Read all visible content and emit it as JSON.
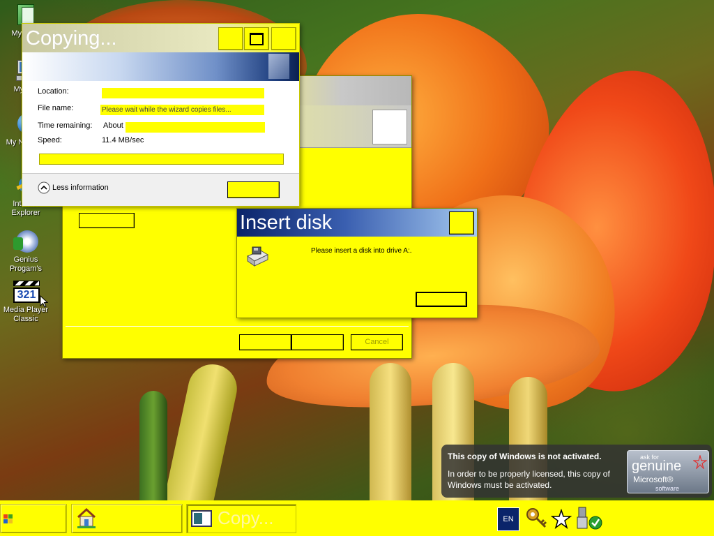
{
  "desktop": {
    "icons": [
      {
        "id": "my-documents",
        "label": "My Do..."
      },
      {
        "id": "my-computer",
        "label": "My C..."
      },
      {
        "id": "my-network-places",
        "label": "My N... Pl..."
      },
      {
        "id": "internet-explorer",
        "label": "Internet Explorer"
      },
      {
        "id": "genius-programs",
        "label": "Genius Progam's"
      },
      {
        "id": "media-player-classic",
        "label": "Media Player Classic"
      }
    ]
  },
  "copying_dialog": {
    "title": "Copying...",
    "location_label": "Location:",
    "location_value": "",
    "file_name_label": "File name:",
    "file_name_value": "Please wait while the wizard copies files...",
    "time_remaining_label": "Time remaining:",
    "time_remaining_value": "About",
    "speed_label": "Speed:",
    "speed_value": "11.4 MB/sec",
    "progress_fraction": 0.0,
    "less_info_label": "Less information",
    "cancel_label": ""
  },
  "wizard_window": {
    "cancel_label": "Cancel",
    "back_label": "",
    "next_label": ""
  },
  "insert_disk_dialog": {
    "title": "Insert disk",
    "message": "Please insert a disk into drive A:.",
    "ok_label": ""
  },
  "activation_balloon": {
    "heading": "This copy of Windows is not activated.",
    "body": "In order to be properly licensed, this copy of Windows must be activated.",
    "badge_top": "ask for",
    "badge_genuine": "genuine",
    "badge_microsoft": "Microsoft®",
    "badge_software": "software"
  },
  "taskbar": {
    "start_label": "",
    "task_copying_label": "Copy...",
    "language": "EN"
  }
}
